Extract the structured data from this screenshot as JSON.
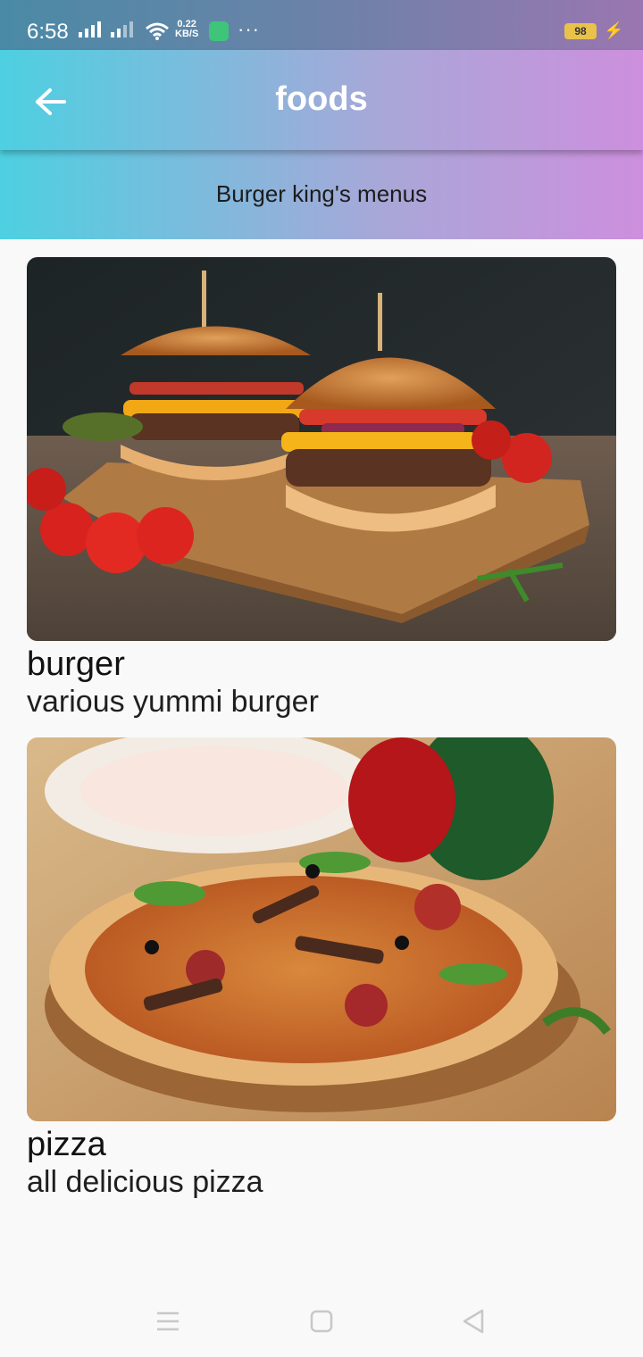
{
  "status_bar": {
    "time": "6:58",
    "net_speed_value": "0.22",
    "net_speed_unit": "KB/S",
    "battery_level": "98"
  },
  "app_bar": {
    "title": "foods",
    "back_icon": "arrow-left-icon"
  },
  "sub_header": {
    "text": "Burger king's menus"
  },
  "items": [
    {
      "title": "burger",
      "description": "various yummi burger",
      "image": "burger-photo"
    },
    {
      "title": "pizza",
      "description": "all delicious pizza",
      "image": "pizza-photo"
    }
  ],
  "nav_bar": {
    "buttons": [
      "menu-icon",
      "home-icon",
      "back-icon"
    ]
  },
  "colors": {
    "app_bar_start": "#4dd0e1",
    "app_bar_end": "#cd8fdd",
    "background": "#f9f9f9"
  }
}
